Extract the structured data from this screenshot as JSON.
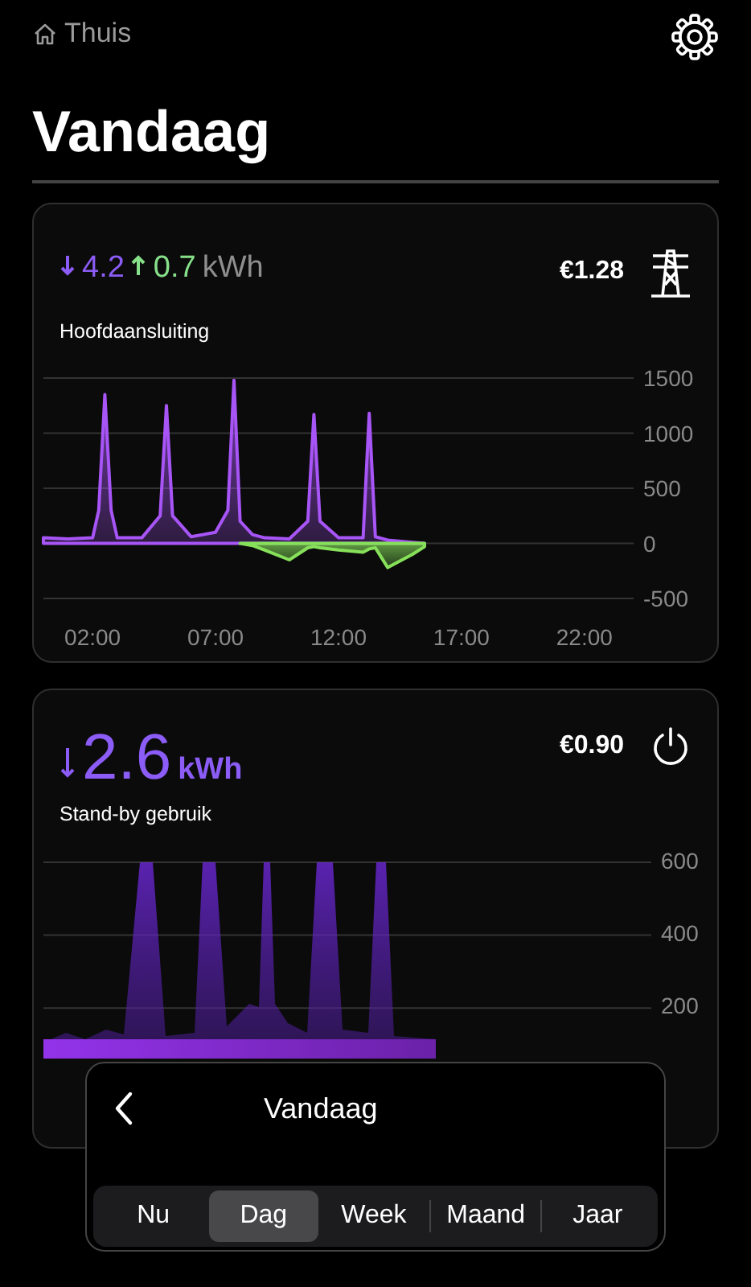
{
  "breadcrumb": {
    "label": "Thuis"
  },
  "title": "Vandaag",
  "cards": [
    {
      "kind": "grid",
      "import": "4.2",
      "export": "0.7",
      "unit": "kWh",
      "price": "€1.28",
      "label": "Hoofdaansluiting",
      "chart_data": {
        "type": "area",
        "x": [
          0,
          1,
          2,
          2.25,
          2.5,
          2.75,
          3,
          4,
          4.75,
          5,
          5.25,
          6,
          7,
          7.5,
          7.75,
          8,
          8.5,
          9,
          10,
          10.75,
          11,
          11.25,
          12,
          13,
          13.25,
          13.5,
          14,
          15,
          15.5
        ],
        "xlim": [
          0,
          24
        ],
        "ylim": [
          -500,
          1500
        ],
        "grid": true,
        "xticks": [
          {
            "value": 2,
            "label": "02:00"
          },
          {
            "value": 7,
            "label": "07:00"
          },
          {
            "value": 12,
            "label": "12:00"
          },
          {
            "value": 17,
            "label": "17:00"
          },
          {
            "value": 22,
            "label": "22:00"
          }
        ],
        "yticks": [
          -500,
          0,
          500,
          1000,
          1500
        ],
        "series": [
          {
            "color": "#a855f7",
            "values": [
              50,
              40,
              50,
              300,
              1350,
              300,
              50,
              50,
              250,
              1250,
              250,
              60,
              100,
              300,
              1480,
              200,
              80,
              50,
              40,
              200,
              1170,
              200,
              50,
              50,
              1180,
              60,
              30,
              10,
              0
            ]
          },
          {
            "color": "#86e05a",
            "values": [
              null,
              null,
              null,
              null,
              null,
              null,
              null,
              null,
              null,
              null,
              null,
              null,
              null,
              null,
              null,
              0,
              -20,
              -60,
              -150,
              -40,
              -30,
              -40,
              -60,
              -80,
              -50,
              -40,
              -220,
              -100,
              -30
            ]
          }
        ]
      }
    },
    {
      "kind": "standby",
      "import": "2.6",
      "unit": "kWh",
      "price": "€0.90",
      "label": "Stand-by gebruik",
      "axis_labels": [
        "600",
        "400",
        "200"
      ]
    }
  ],
  "period": {
    "title": "Vandaag",
    "options": [
      {
        "label": "Nu",
        "selected": false
      },
      {
        "label": "Dag",
        "selected": true
      },
      {
        "label": "Week",
        "selected": false
      },
      {
        "label": "Maand",
        "selected": false
      },
      {
        "label": "Jaar",
        "selected": false
      }
    ]
  }
}
